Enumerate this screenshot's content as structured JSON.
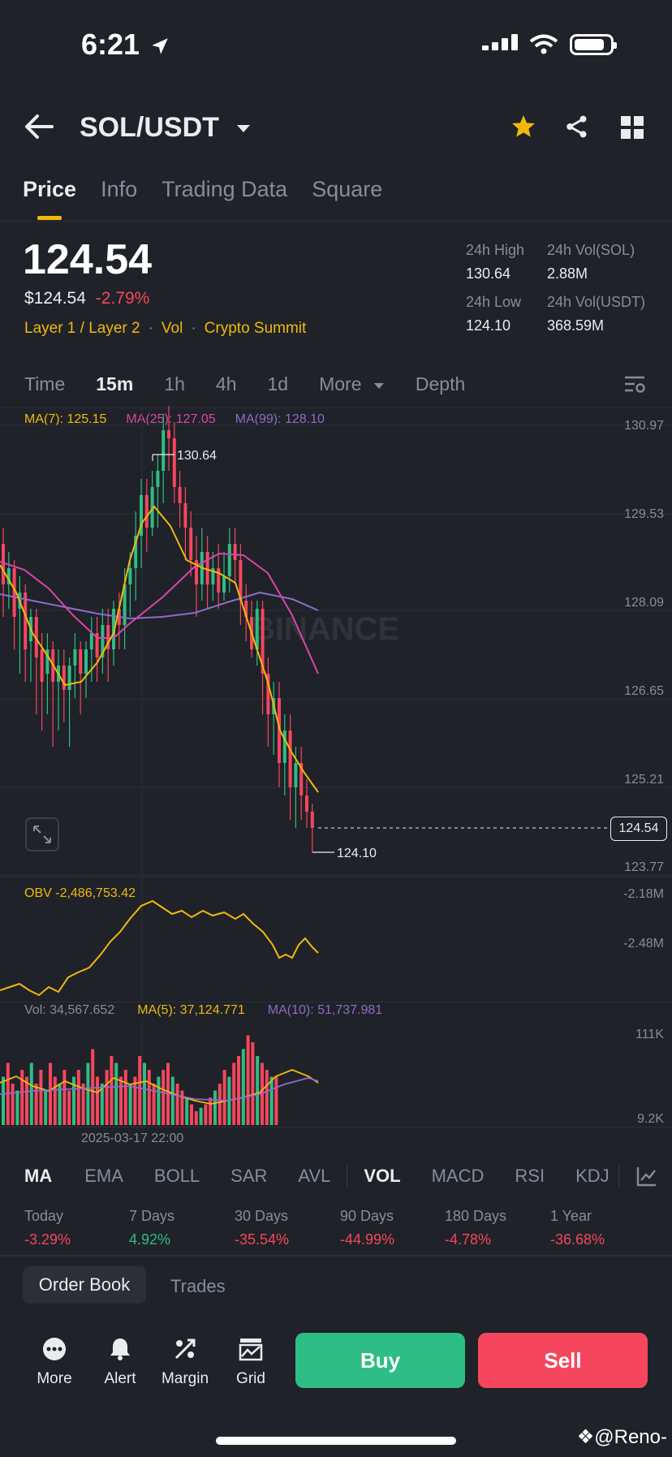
{
  "status": {
    "time": "6:21"
  },
  "header": {
    "pair": "SOL/USDT"
  },
  "tabs": [
    "Price",
    "Info",
    "Trading Data",
    "Square"
  ],
  "price": {
    "last": "124.54",
    "fiat": "$124.54",
    "change": "-2.79%",
    "tags": [
      "Layer 1 / Layer 2",
      "Vol",
      "Crypto Summit"
    ]
  },
  "stats": {
    "high_label": "24h High",
    "high": "130.64",
    "low_label": "24h Low",
    "low": "124.10",
    "vol_sol_label": "24h Vol(SOL)",
    "vol_sol": "2.88M",
    "vol_usdt_label": "24h Vol(USDT)",
    "vol_usdt": "368.59M"
  },
  "timeframes": [
    "Time",
    "15m",
    "1h",
    "4h",
    "1d",
    "More",
    "Depth"
  ],
  "ma_legend": {
    "ma7": "MA(7): 125.15",
    "ma25": "MA(25): 127.05",
    "ma99": "MA(99): 128.10"
  },
  "price_axis": [
    "130.97",
    "129.53",
    "128.09",
    "126.65",
    "125.21",
    "123.77"
  ],
  "current_price_tag": "124.54",
  "high_marker": "130.64",
  "low_marker": "124.10",
  "watermark_logo": "BINANCE",
  "obv": {
    "label": "OBV -2,486,753.42",
    "axis": [
      "-2.18M",
      "-2.48M"
    ]
  },
  "volume": {
    "vol_label": "Vol: 34,567.652",
    "ma5": "MA(5): 37,124.771",
    "ma10": "MA(10): 51,737.981",
    "axis": [
      "111K",
      "9.2K"
    ],
    "date": "2025-03-17 22:00"
  },
  "indicators": [
    "MA",
    "EMA",
    "BOLL",
    "SAR",
    "AVL",
    "VOL",
    "MACD",
    "RSI",
    "KDJ"
  ],
  "performance": [
    {
      "label": "Today",
      "value": "-3.29%"
    },
    {
      "label": "7 Days",
      "value": "4.92%"
    },
    {
      "label": "30 Days",
      "value": "-35.54%"
    },
    {
      "label": "90 Days",
      "value": "-44.99%"
    },
    {
      "label": "180 Days",
      "value": "-4.78%"
    },
    {
      "label": "1 Year",
      "value": "-36.68%"
    }
  ],
  "bottom_tabs": {
    "order_book": "Order Book",
    "trades": "Trades"
  },
  "bottom_nav": [
    "More",
    "Alert",
    "Margin",
    "Grid"
  ],
  "actions": {
    "buy": "Buy",
    "sell": "Sell"
  },
  "watermark_user": "@Reno-",
  "colors": {
    "up": "#2ebd85",
    "down": "#f6465d",
    "accent": "#f0b90b",
    "ma25": "#d946a8",
    "ma99": "#8e6cc7"
  }
}
